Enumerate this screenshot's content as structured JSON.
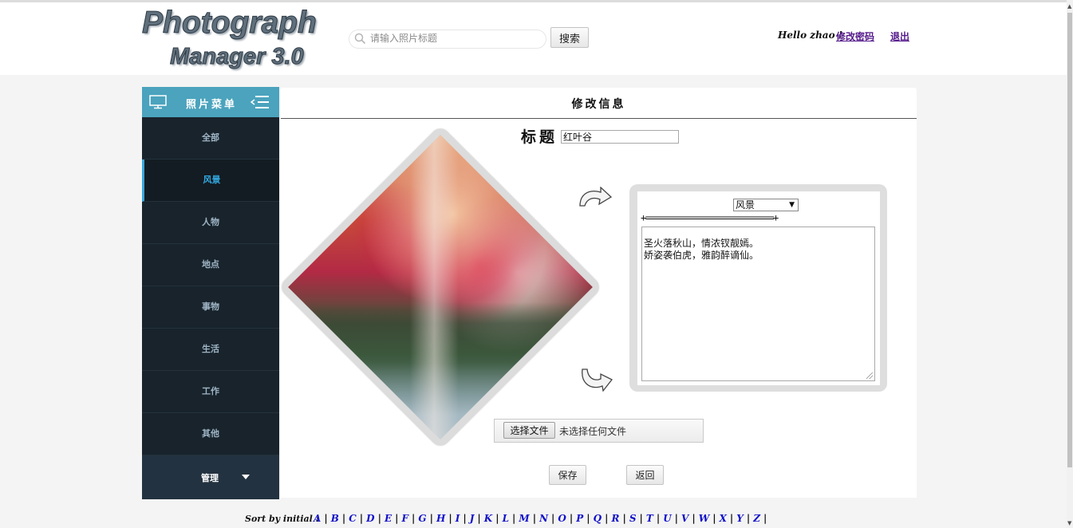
{
  "app": {
    "logo_line1": "Photograph",
    "logo_line2": "Manager 3.0"
  },
  "header": {
    "search_placeholder": "请输入照片标题",
    "search_button": "搜索",
    "greeting": "Hello zhao !",
    "change_password": "修改密码",
    "logout": "退出"
  },
  "sidebar": {
    "title": "照片菜单",
    "items": [
      {
        "label": "全部",
        "active": false
      },
      {
        "label": "风景",
        "active": true
      },
      {
        "label": "人物",
        "active": false
      },
      {
        "label": "地点",
        "active": false
      },
      {
        "label": "事物",
        "active": false
      },
      {
        "label": "生活",
        "active": false
      },
      {
        "label": "工作",
        "active": false
      },
      {
        "label": "其他",
        "active": false
      }
    ],
    "manage": "管理"
  },
  "main": {
    "heading": "修改信息",
    "title_label": "标题",
    "title_value": "红叶谷",
    "category_value": "风景",
    "divider": "+============================+",
    "description": "圣火落秋山，情浓钗靓嫣。\n娇姿袭伯虎，雅韵醉谪仙。",
    "file_button": "选择文件",
    "file_status": "未选择任何文件",
    "save_button": "保存",
    "back_button": "返回"
  },
  "footer": {
    "sort_label": "Sort by initial :",
    "letters": [
      "A",
      "B",
      "C",
      "D",
      "E",
      "F",
      "G",
      "H",
      "I",
      "J",
      "K",
      "L",
      "M",
      "N",
      "O",
      "P",
      "Q",
      "R",
      "S",
      "T",
      "U",
      "V",
      "W",
      "X",
      "Y",
      "Z"
    ]
  },
  "colors": {
    "sidebar_bg": "#18232c",
    "sidebar_header": "#4ba3bd",
    "active_item": "#32a9e0",
    "link": "#551a8b",
    "letter_link": "#1010c8"
  }
}
